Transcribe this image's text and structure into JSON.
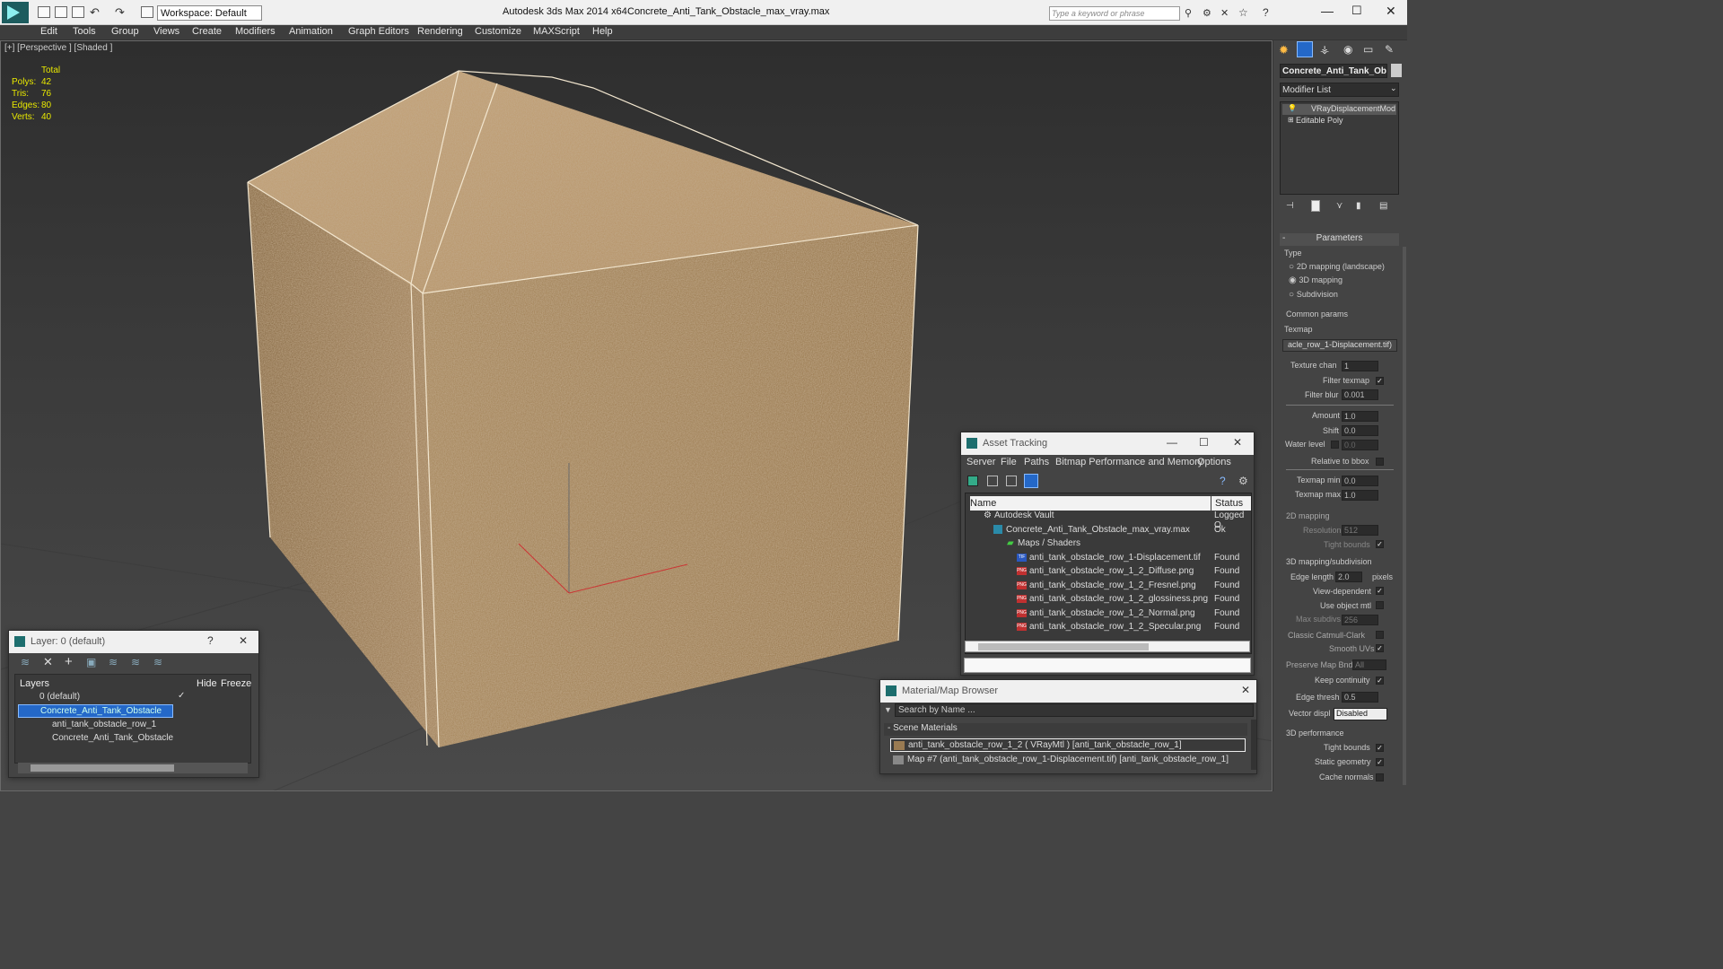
{
  "app": {
    "title": "Autodesk 3ds Max  2014 x64",
    "file": "Concrete_Anti_Tank_Obstacle_max_vray.max",
    "workspace": "Workspace: Default",
    "search_placeholder": "Type a keyword or phrase"
  },
  "menu": [
    "Edit",
    "Tools",
    "Group",
    "Views",
    "Create",
    "Modifiers",
    "Animation",
    "Graph Editors",
    "Rendering",
    "Customize",
    "MAXScript",
    "Help"
  ],
  "viewport": {
    "label": "[+] [Perspective ] [Shaded ]",
    "stats": {
      "header": "Total",
      "rows": [
        {
          "k": "Polys:",
          "v": "42"
        },
        {
          "k": "Tris:",
          "v": "76"
        },
        {
          "k": "Edges:",
          "v": "80"
        },
        {
          "k": "Verts:",
          "v": "40"
        }
      ]
    }
  },
  "layer_panel": {
    "title": "Layer: 0 (default)",
    "help": "?",
    "cols": [
      "Layers",
      "Hide",
      "Freeze"
    ],
    "rows": [
      "0 (default)",
      "Concrete_Anti_Tank_Obstacle",
      "anti_tank_obstacle_row_1",
      "Concrete_Anti_Tank_Obstacle"
    ]
  },
  "asset_tracking": {
    "title": "Asset Tracking",
    "menu": [
      "Server",
      "File",
      "Paths",
      "Bitmap Performance and Memory",
      "Options"
    ],
    "cols": [
      "Name",
      "Status"
    ],
    "rows": [
      {
        "name": "Autodesk Vault",
        "status": "Logged O"
      },
      {
        "name": "Concrete_Anti_Tank_Obstacle_max_vray.max",
        "status": "Ok"
      },
      {
        "name": "Maps / Shaders",
        "status": ""
      },
      {
        "name": "anti_tank_obstacle_row_1-Displacement.tif",
        "status": "Found",
        "ext": "TIF"
      },
      {
        "name": "anti_tank_obstacle_row_1_2_Diffuse.png",
        "status": "Found",
        "ext": "PNG"
      },
      {
        "name": "anti_tank_obstacle_row_1_2_Fresnel.png",
        "status": "Found",
        "ext": "PNG"
      },
      {
        "name": "anti_tank_obstacle_row_1_2_glossiness.png",
        "status": "Found",
        "ext": "PNG"
      },
      {
        "name": "anti_tank_obstacle_row_1_2_Normal.png",
        "status": "Found",
        "ext": "PNG"
      },
      {
        "name": "anti_tank_obstacle_row_1_2_Specular.png",
        "status": "Found",
        "ext": "PNG"
      }
    ]
  },
  "material_browser": {
    "title": "Material/Map Browser",
    "search": "Search by Name ...",
    "section": "Scene Materials",
    "items": [
      "anti_tank_obstacle_row_1_2  ( VRayMtl )  [anti_tank_obstacle_row_1]",
      "Map #7 (anti_tank_obstacle_row_1-Displacement.tif) [anti_tank_obstacle_row_1]"
    ]
  },
  "command_panel": {
    "object_name": "Concrete_Anti_Tank_Obs",
    "modifier_list": "Modifier List",
    "stack": [
      "VRayDisplacementMod",
      "Editable Poly"
    ],
    "rollout": "Parameters",
    "type_label": "Type",
    "types": [
      "2D mapping (landscape)",
      "3D mapping",
      "Subdivision"
    ],
    "common": "Common params",
    "texmap_label": "Texmap",
    "texmap": "acle_row_1-Displacement.tif)",
    "texture_chan": {
      "label": "Texture chan",
      "value": "1"
    },
    "filter_texmap": "Filter texmap",
    "filter_blur": {
      "label": "Filter blur",
      "value": "0.001"
    },
    "amount": {
      "label": "Amount",
      "value": "1.0"
    },
    "shift": {
      "label": "Shift",
      "value": "0.0"
    },
    "water": {
      "label": "Water level",
      "value": "0.0"
    },
    "relative": "Relative to bbox",
    "texmap_min": {
      "label": "Texmap min",
      "value": "0.0"
    },
    "texmap_max": {
      "label": "Texmap max",
      "value": "1.0"
    },
    "mapping2d": "2D mapping",
    "resolution": {
      "label": "Resolution",
      "value": "512"
    },
    "tight_bounds": "Tight bounds",
    "mapping3d": "3D mapping/subdivision",
    "edge_length": {
      "label": "Edge length",
      "value": "2.0",
      "unit": "pixels"
    },
    "view_dep": "View-dependent",
    "use_obj": "Use object mtl",
    "max_subdivs": {
      "label": "Max subdivs",
      "value": "256"
    },
    "catmull": "Classic Catmull-Clark",
    "smooth_uvs": "Smooth UVs",
    "preserve": {
      "label": "Preserve Map Bnd",
      "value": "All"
    },
    "keep": "Keep continuity",
    "edge_thresh": {
      "label": "Edge thresh",
      "value": "0.5"
    },
    "vector": {
      "label": "Vector displ",
      "value": "Disabled"
    },
    "perf": "3D performance",
    "perf_items": [
      "Tight bounds",
      "Static geometry",
      "Cache normals"
    ]
  }
}
